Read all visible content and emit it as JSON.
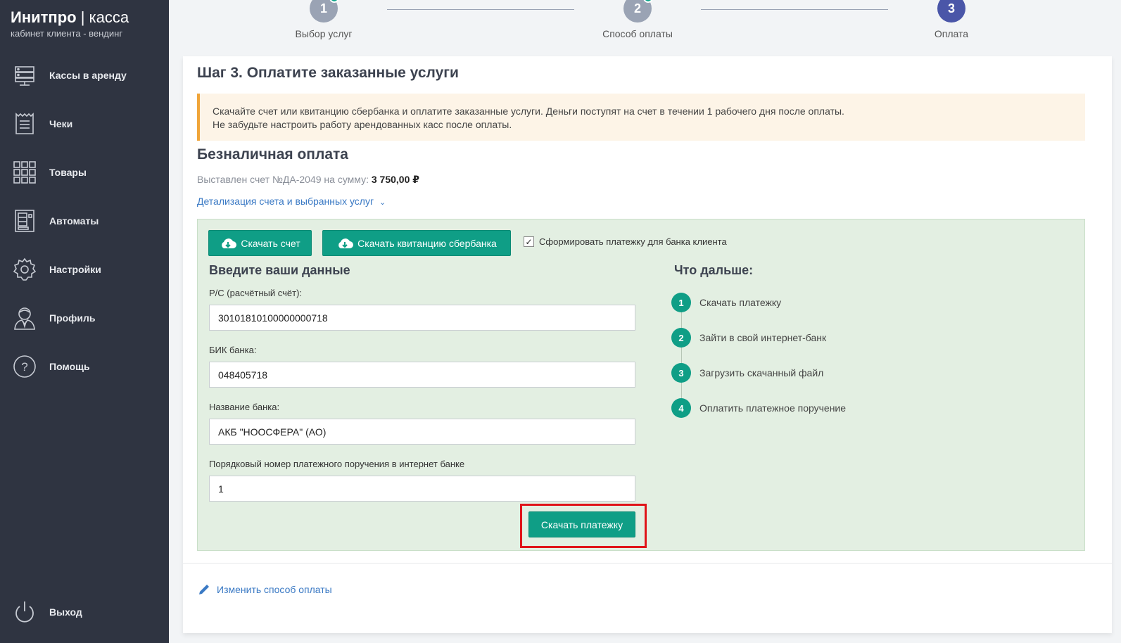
{
  "brand": {
    "name_bold": "Инитпро",
    "separator": "|",
    "name_light": "касса",
    "subtitle": "кабинет клиента - вендинг"
  },
  "sidebar": {
    "items": [
      {
        "label": "Кассы в аренду",
        "icon": "server-icon"
      },
      {
        "label": "Чеки",
        "icon": "receipt-icon"
      },
      {
        "label": "Товары",
        "icon": "grid-icon"
      },
      {
        "label": "Автоматы",
        "icon": "vending-machine-icon"
      },
      {
        "label": "Настройки",
        "icon": "gear-icon"
      },
      {
        "label": "Профиль",
        "icon": "user-icon"
      },
      {
        "label": "Помощь",
        "icon": "help-icon"
      }
    ],
    "logout": {
      "label": "Выход",
      "icon": "power-icon"
    }
  },
  "stepper": {
    "steps": [
      {
        "number": "1",
        "label": "Выбор услуг",
        "state": "done"
      },
      {
        "number": "2",
        "label": "Способ оплаты",
        "state": "done"
      },
      {
        "number": "3",
        "label": "Оплата",
        "state": "active"
      }
    ]
  },
  "main": {
    "title": "Шаг 3. Оплатите заказанные услуги",
    "alert": {
      "line1": "Скачайте счет или квитанцию сбербанка и оплатите заказанные услуги. Деньги поступят на счет в течении 1 рабочего дня после оплаты.",
      "line2": "Не забудьте настроить работу арендованных касс после оплаты."
    },
    "section_title": "Безналичная оплата",
    "invoice_prefix": "Выставлен счет №ДА-2049 на сумму:",
    "invoice_amount": "3 750,00 ₽",
    "details_link": "Детализация счета и выбранных услуг",
    "change_payment_link": "Изменить способ оплаты"
  },
  "panel": {
    "download_invoice": "Скачать счет",
    "download_receipt": "Скачать квитанцию сбербанка",
    "checkbox_label": "Сформировать платежку для банка клиента",
    "checkbox_checked": true,
    "form_title": "Введите ваши данные",
    "fields": [
      {
        "label": "Р/С (расчётный счёт):",
        "value": "30101810100000000718"
      },
      {
        "label": "БИК банка:",
        "value": "048405718"
      },
      {
        "label": "Название банка:",
        "value": "АКБ \"НООСФЕРА\" (АО)"
      },
      {
        "label": "Порядковый номер платежного поручения в интернет банке",
        "value": "1"
      }
    ],
    "submit_label": "Скачать платежку",
    "next_title": "Что дальше:",
    "next_steps": [
      {
        "number": "1",
        "text": "Скачать платежку"
      },
      {
        "number": "2",
        "text": "Зайти в свой интернет-банк"
      },
      {
        "number": "3",
        "text": "Загрузить скачанный файл"
      },
      {
        "number": "4",
        "text": "Оплатить платежное поручение"
      }
    ]
  },
  "colors": {
    "sidebar_bg": "#2f3441",
    "accent_green": "#0f9e86",
    "active_step": "#4a56a8",
    "link": "#3a79c4",
    "highlight": "#e0141a"
  }
}
